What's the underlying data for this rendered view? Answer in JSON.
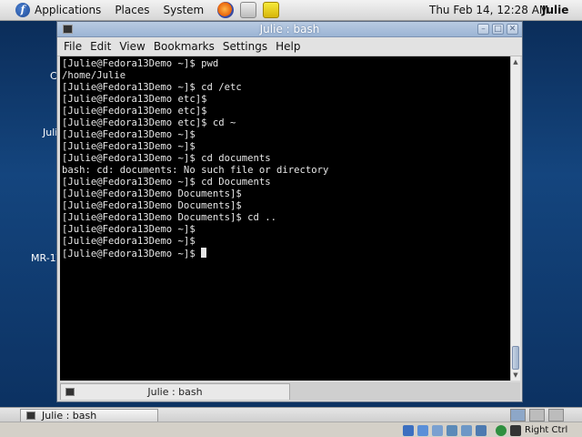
{
  "top_panel": {
    "logo_glyph": "f",
    "menus": [
      "Applications",
      "Places",
      "System"
    ],
    "launchers": [
      "firefox-icon",
      "mail-icon",
      "notes-icon"
    ],
    "clock": "Thu Feb 14, 12:28 AM",
    "user": "Julie"
  },
  "desktop": {
    "fragments": [
      "C",
      "Juli",
      "MR-1V"
    ]
  },
  "window": {
    "title": "Julie : bash",
    "controls": [
      "minimize",
      "maximize",
      "close"
    ],
    "menu": [
      "File",
      "Edit",
      "View",
      "Bookmarks",
      "Settings",
      "Help"
    ],
    "lines": [
      "[Julie@Fedora13Demo ~]$ pwd",
      "/home/Julie",
      "[Julie@Fedora13Demo ~]$ cd /etc",
      "[Julie@Fedora13Demo etc]$",
      "[Julie@Fedora13Demo etc]$",
      "[Julie@Fedora13Demo etc]$ cd ~",
      "[Julie@Fedora13Demo ~]$",
      "[Julie@Fedora13Demo ~]$",
      "[Julie@Fedora13Demo ~]$ cd documents",
      "bash: cd: documents: No such file or directory",
      "[Julie@Fedora13Demo ~]$ cd Documents",
      "[Julie@Fedora13Demo Documents]$",
      "[Julie@Fedora13Demo Documents]$",
      "[Julie@Fedora13Demo Documents]$ cd ..",
      "[Julie@Fedora13Demo ~]$",
      "[Julie@Fedora13Demo ~]$",
      "[Julie@Fedora13Demo ~]$ "
    ],
    "tab_label": "Julie : bash"
  },
  "bottom_panel": {
    "task_label": "Julie : bash"
  },
  "vm_bar": {
    "host_key": "Right Ctrl"
  }
}
